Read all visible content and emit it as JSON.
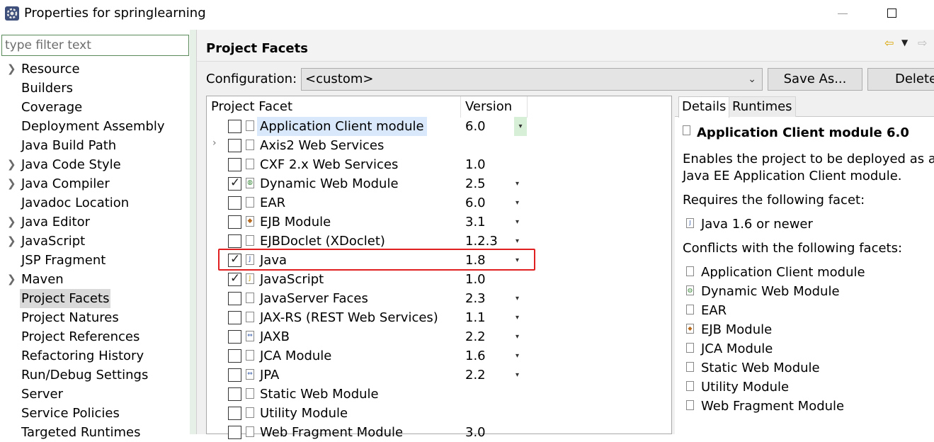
{
  "window": {
    "title": "Properties for springlearning",
    "maximize_glyph": ""
  },
  "filter": {
    "placeholder": "type filter text",
    "value": ""
  },
  "nav": {
    "items": [
      {
        "label": "Resource",
        "expandable": true,
        "selected": false
      },
      {
        "label": "Builders",
        "expandable": false,
        "selected": false
      },
      {
        "label": "Coverage",
        "expandable": false,
        "selected": false
      },
      {
        "label": "Deployment Assembly",
        "expandable": false,
        "selected": false
      },
      {
        "label": "Java Build Path",
        "expandable": false,
        "selected": false
      },
      {
        "label": "Java Code Style",
        "expandable": true,
        "selected": false
      },
      {
        "label": "Java Compiler",
        "expandable": true,
        "selected": false
      },
      {
        "label": "Javadoc Location",
        "expandable": false,
        "selected": false
      },
      {
        "label": "Java Editor",
        "expandable": true,
        "selected": false
      },
      {
        "label": "JavaScript",
        "expandable": true,
        "selected": false
      },
      {
        "label": "JSP Fragment",
        "expandable": false,
        "selected": false
      },
      {
        "label": "Maven",
        "expandable": true,
        "selected": false
      },
      {
        "label": "Project Facets",
        "expandable": false,
        "selected": true
      },
      {
        "label": "Project Natures",
        "expandable": false,
        "selected": false
      },
      {
        "label": "Project References",
        "expandable": false,
        "selected": false
      },
      {
        "label": "Refactoring History",
        "expandable": false,
        "selected": false
      },
      {
        "label": "Run/Debug Settings",
        "expandable": false,
        "selected": false
      },
      {
        "label": "Server",
        "expandable": false,
        "selected": false
      },
      {
        "label": "Service Policies",
        "expandable": false,
        "selected": false
      },
      {
        "label": "Targeted Runtimes",
        "expandable": false,
        "selected": false
      }
    ]
  },
  "page": {
    "title": "Project Facets"
  },
  "configuration": {
    "label": "Configuration:",
    "value": "<custom>",
    "save_as_label": "Save As...",
    "delete_label": "Delete"
  },
  "facet_table": {
    "headers": {
      "facet": "Project Facet",
      "version": "Version"
    },
    "rows": [
      {
        "name": "Application Client module",
        "version": "6.0",
        "checked": false,
        "expandable": false,
        "dropdown": true,
        "selected": true,
        "icon": "page-icon"
      },
      {
        "name": "Axis2 Web Services",
        "version": "",
        "checked": false,
        "expandable": true,
        "dropdown": false,
        "selected": false,
        "icon": "page-icon"
      },
      {
        "name": "CXF 2.x Web Services",
        "version": "1.0",
        "checked": false,
        "expandable": false,
        "dropdown": false,
        "selected": false,
        "icon": "page-icon"
      },
      {
        "name": "Dynamic Web Module",
        "version": "2.5",
        "checked": true,
        "expandable": false,
        "dropdown": true,
        "selected": false,
        "icon": "globe-icon"
      },
      {
        "name": "EAR",
        "version": "6.0",
        "checked": false,
        "expandable": false,
        "dropdown": true,
        "selected": false,
        "icon": "page-icon"
      },
      {
        "name": "EJB Module",
        "version": "3.1",
        "checked": false,
        "expandable": false,
        "dropdown": true,
        "selected": false,
        "icon": "bean-icon"
      },
      {
        "name": "EJBDoclet (XDoclet)",
        "version": "1.2.3",
        "checked": false,
        "expandable": false,
        "dropdown": true,
        "selected": false,
        "icon": "page-icon"
      },
      {
        "name": "Java",
        "version": "1.8",
        "checked": true,
        "expandable": false,
        "dropdown": true,
        "selected": false,
        "icon": "java-icon"
      },
      {
        "name": "JavaScript",
        "version": "1.0",
        "checked": true,
        "expandable": false,
        "dropdown": false,
        "selected": false,
        "icon": "js-icon"
      },
      {
        "name": "JavaServer Faces",
        "version": "2.3",
        "checked": false,
        "expandable": false,
        "dropdown": true,
        "selected": false,
        "icon": "page-icon"
      },
      {
        "name": "JAX-RS (REST Web Services)",
        "version": "1.1",
        "checked": false,
        "expandable": false,
        "dropdown": true,
        "selected": false,
        "icon": "page-icon"
      },
      {
        "name": "JAXB",
        "version": "2.2",
        "checked": false,
        "expandable": false,
        "dropdown": true,
        "selected": false,
        "icon": "arrows-icon"
      },
      {
        "name": "JCA Module",
        "version": "1.6",
        "checked": false,
        "expandable": false,
        "dropdown": true,
        "selected": false,
        "icon": "page-icon"
      },
      {
        "name": "JPA",
        "version": "2.2",
        "checked": false,
        "expandable": false,
        "dropdown": true,
        "selected": false,
        "icon": "arrows-icon"
      },
      {
        "name": "Static Web Module",
        "version": "",
        "checked": false,
        "expandable": false,
        "dropdown": false,
        "selected": false,
        "icon": "page-icon"
      },
      {
        "name": "Utility Module",
        "version": "",
        "checked": false,
        "expandable": false,
        "dropdown": false,
        "selected": false,
        "icon": "page-icon"
      },
      {
        "name": "Web Fragment Module",
        "version": "3.0",
        "checked": false,
        "expandable": false,
        "dropdown": false,
        "selected": false,
        "icon": "page-icon"
      }
    ]
  },
  "details": {
    "tabs": [
      "Details",
      "Runtimes"
    ],
    "title": "Application Client module 6.0",
    "description_line1": "Enables the project to be deployed as a",
    "description_line2": "Java EE Application Client module.",
    "requires_label": "Requires the following facet:",
    "requires": [
      "Java 1.6 or newer"
    ],
    "conflicts_label": "Conflicts with the following facets:",
    "conflicts": [
      {
        "name": "Application Client module",
        "icon": "page-icon"
      },
      {
        "name": "Dynamic Web Module",
        "icon": "globe-icon"
      },
      {
        "name": "EAR",
        "icon": "page-icon"
      },
      {
        "name": "EJB Module",
        "icon": "bean-icon"
      },
      {
        "name": "JCA Module",
        "icon": "page-icon"
      },
      {
        "name": "Static Web Module",
        "icon": "page-icon"
      },
      {
        "name": "Utility Module",
        "icon": "page-icon"
      },
      {
        "name": "Web Fragment Module",
        "icon": "page-icon"
      }
    ]
  },
  "colors": {
    "accent_green": "#5a8a5a",
    "highlight_red": "#e02020",
    "selection_blue": "#d9e8fb"
  }
}
